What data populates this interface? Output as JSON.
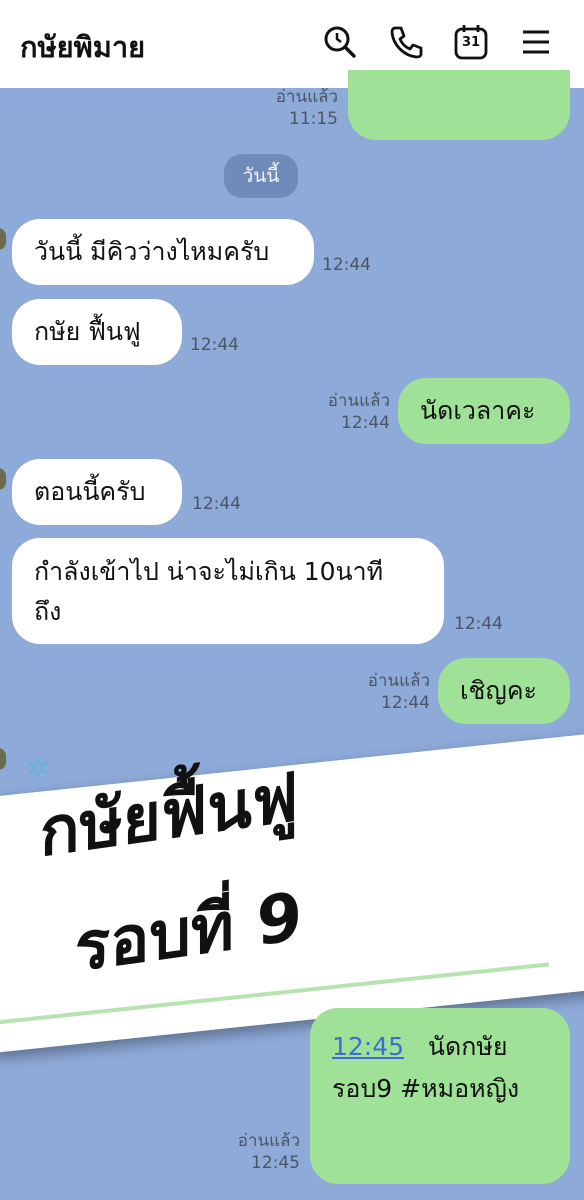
{
  "header": {
    "title": "กษัยพิมาย",
    "calendar_day": "31",
    "icons": [
      "search-icon",
      "phone-icon",
      "calendar-icon",
      "menu-icon"
    ]
  },
  "date_separator": "วันนี้",
  "messages": [
    {
      "side": "out",
      "text": "",
      "read": "อ่านแล้ว",
      "time": "11:15"
    },
    {
      "side": "in",
      "text": "วันนี้ มีคิวว่างไหมครับ",
      "time": "12:44"
    },
    {
      "side": "in",
      "text": "กษัย ฟื้นฟู",
      "time": "12:44"
    },
    {
      "side": "out",
      "text": "นัดเวลาคะ",
      "read": "อ่านแล้ว",
      "time": "12:44"
    },
    {
      "side": "in",
      "text": "ตอนนี้ครับ",
      "time": "12:44"
    },
    {
      "side": "in",
      "line1": "กำลังเข้าไป น่าจะไม่เกิน 10นาที",
      "line2": "ถึง",
      "time": "12:44"
    },
    {
      "side": "out",
      "text": "เชิญคะ",
      "read": "อ่านแล้ว",
      "time": "12:44"
    },
    {
      "side": "out",
      "link_time": "12:45",
      "line1_rest": "นัดกษัย",
      "line2": "รอบ9  #หมอหญิง",
      "read": "อ่านแล้ว",
      "time": "12:45"
    }
  ],
  "overlay": {
    "line1": "กษัยฟื้นฟู",
    "line2": "รอบที่  9"
  },
  "colors": {
    "background": "#8eaad9",
    "incoming": "#ffffff",
    "outgoing": "#9fe196",
    "link": "#3b6fd6"
  }
}
